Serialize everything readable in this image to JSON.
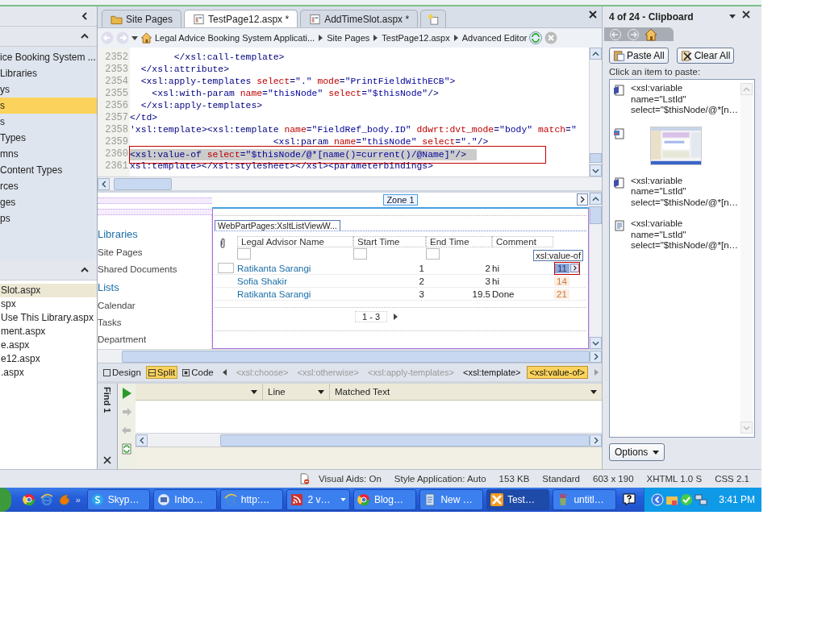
{
  "left_nav": {
    "site_items": [
      {
        "label": "ice Booking System ...",
        "selected": false
      },
      {
        "label": "Libraries",
        "selected": false
      },
      {
        "label": "ys",
        "selected": false
      },
      {
        "label": "s",
        "selected": true
      },
      {
        "label": "s",
        "selected": false
      },
      {
        "label": "Types",
        "selected": false
      },
      {
        "label": "mns",
        "selected": false
      },
      {
        "label": "Content Types",
        "selected": false
      },
      {
        "label": "rces",
        "selected": false
      },
      {
        "label": "ges",
        "selected": false
      },
      {
        "label": "ps",
        "selected": false
      }
    ],
    "file_items": [
      {
        "label": "Slot.aspx",
        "selected": true
      },
      {
        "label": "spx",
        "selected": false
      },
      {
        "label": "Use This Library.aspx",
        "selected": false
      },
      {
        "label": "ment.aspx",
        "selected": false
      },
      {
        "label": "e.aspx",
        "selected": false
      },
      {
        "label": "e12.aspx",
        "selected": false
      },
      {
        "label": ".aspx",
        "selected": false
      }
    ]
  },
  "document_tabs": [
    {
      "label": "Site Pages",
      "selected": false,
      "kind": "folder"
    },
    {
      "label": "TestPage12.aspx *",
      "selected": true,
      "kind": "page"
    },
    {
      "label": "AddTimeSlot.aspx *",
      "selected": false,
      "kind": "page"
    }
  ],
  "breadcrumb": [
    "Legal Advice Booking System Applicati...",
    "Site Pages",
    "TestPage12.aspx",
    "Advanced Editor"
  ],
  "code_view": {
    "lines": [
      {
        "number": "2352",
        "text": "        </xsl:call-template>",
        "selected": false
      },
      {
        "number": "2353",
        "text": "  </xsl:attribute>",
        "selected": false
      },
      {
        "number": "2354",
        "text": "  <xsl:apply-templates select=\".\" mode=\"PrintFieldWithECB\">",
        "selected": false
      },
      {
        "number": "2355",
        "text": "    <xsl:with-param name=\"thisNode\" select=\"$thisNode\"/>",
        "selected": false
      },
      {
        "number": "2356",
        "text": "  </xsl:apply-templates>",
        "selected": false
      },
      {
        "number": "2357",
        "text": "</td>",
        "selected": false
      },
      {
        "number": "2358",
        "text": "'xsl:template><xsl:template name=\"FieldRef_body.ID\" ddwrt:dvt_mode=\"body\" match=\"",
        "selected": false
      },
      {
        "number": "2359",
        "text": "                          <xsl:param name=\"thisNode\" select=\".\"/>",
        "selected": false
      },
      {
        "number": "2360",
        "text": "<xsl:value-of select=\"$thisNode/@*[name()=current()/@Name]\"/>",
        "selected": true
      },
      {
        "number": "2361",
        "text": "xsl:template></xsl:stylesheet></xsl><parameterbindings>",
        "selected": false
      }
    ]
  },
  "design_view": {
    "zone_label": "Zone 1",
    "nav_links": [
      {
        "label": "Libraries",
        "kind": "heading"
      },
      {
        "label": "Site Pages",
        "kind": "link"
      },
      {
        "label": "Shared Documents",
        "kind": "link"
      },
      {
        "label": "Lists",
        "kind": "heading"
      },
      {
        "label": "Calendar",
        "kind": "link"
      },
      {
        "label": "Tasks",
        "kind": "link"
      },
      {
        "label": "Department",
        "kind": "link"
      }
    ],
    "web_part_tag": "WebPartPages:XsltListViewW...",
    "columns": [
      "Legal Advisor Name",
      "Start Time",
      "End Time",
      "Comment"
    ],
    "value_tag": "xsl:value-of",
    "rows": [
      {
        "name": "Ratikanta Sarangi",
        "start": "1",
        "end": "2",
        "comment": "hi",
        "value": "11",
        "selected": true
      },
      {
        "name": "Sofia Shakir",
        "start": "2",
        "end": "3",
        "comment": "hi",
        "value": "14",
        "selected": false
      },
      {
        "name": "Ratikanta Sarangi",
        "start": "3",
        "end": "19.5",
        "comment": "Done",
        "value": "21",
        "selected": false
      }
    ],
    "paging": "1 - 3"
  },
  "view_tabs": [
    {
      "label": "Design",
      "selected": false
    },
    {
      "label": "Split",
      "selected": true
    },
    {
      "label": "Code",
      "selected": false
    }
  ],
  "tag_path": [
    {
      "label": "<xsl:choose>",
      "selected": false,
      "dimmed": true
    },
    {
      "label": "<xsl:otherwise>",
      "selected": false,
      "dimmed": true
    },
    {
      "label": "<xsl:apply-templates>",
      "selected": false,
      "dimmed": true
    },
    {
      "label": "<xsl:template>",
      "selected": false,
      "dimmed": false
    },
    {
      "label": "<xsl:value-of>",
      "selected": true,
      "dimmed": false
    }
  ],
  "find_panel": {
    "tab": "Find 1",
    "columns": [
      "Line",
      "Matched Text"
    ]
  },
  "clipboard": {
    "title": "4 of 24 - Clipboard",
    "buttons": [
      {
        "label": "Paste All",
        "kind": "paste"
      },
      {
        "label": "Clear All",
        "kind": "clear"
      }
    ],
    "hint": "Click an item to paste:",
    "items": [
      {
        "kind": "html",
        "lines": [
          "<xsl:variable",
          "name=\"LstId\"",
          "select=\"$thisNode/@*[n…"
        ]
      },
      {
        "kind": "picture"
      },
      {
        "kind": "html",
        "lines": [
          "<xsl:variable",
          "name=\"LstId\"",
          "select=\"$thisNode/@*[n…"
        ]
      },
      {
        "kind": "plain",
        "lines": [
          "<xsl:variable",
          "name=\"LstId\"",
          "select=\"$thisNode/@*[n…"
        ]
      }
    ],
    "options": "Options"
  },
  "status_bar": [
    "Visual Aids: On",
    "Style Application: Auto",
    "153 KB",
    "Standard",
    "603 x 190",
    "XHTML 1.0 S",
    "CSS 2.1"
  ],
  "taskbar": {
    "quick_launch_more": "»",
    "tasks": [
      {
        "label": "Skyp…",
        "kind": "skype",
        "selected": false
      },
      {
        "label": "Inbo…",
        "kind": "mail",
        "selected": false
      },
      {
        "label": "http:…",
        "kind": "ie",
        "selected": false
      },
      {
        "label": "2 v…",
        "kind": "feed",
        "selected": false
      },
      {
        "label": "Blog…",
        "kind": "chrome",
        "selected": false
      },
      {
        "label": "New …",
        "kind": "notepad",
        "selected": false
      },
      {
        "label": "Test…",
        "kind": "designer",
        "selected": true
      },
      {
        "label": "untitl…",
        "kind": "paint",
        "selected": false
      }
    ],
    "clock": "3:41 PM"
  }
}
